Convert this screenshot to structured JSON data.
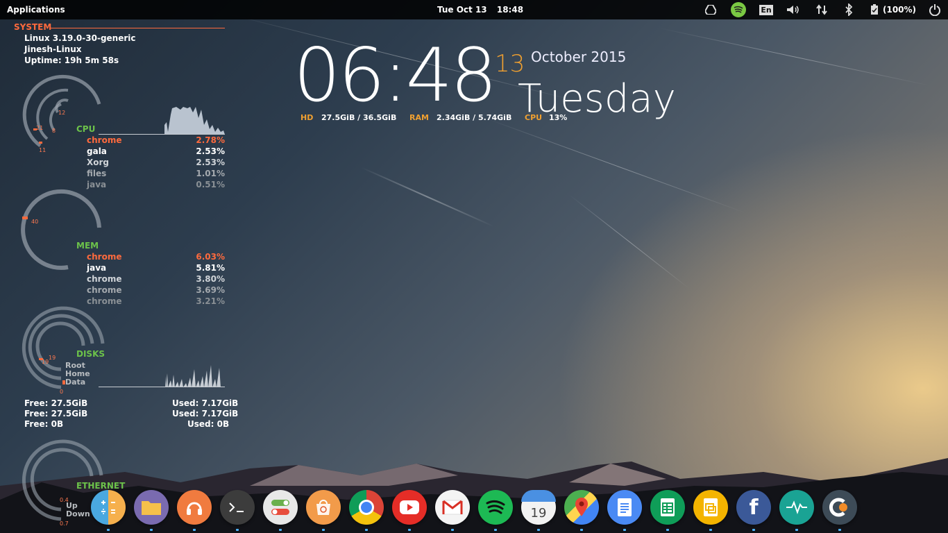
{
  "panel": {
    "apps_menu": "Applications",
    "date": "Tue Oct 13",
    "time": "18:48",
    "battery": "(100%)",
    "keyboard": "En"
  },
  "system": {
    "heading": "SYSTEM",
    "kernel": "Linux 3.19.0-30-generic",
    "host": "Jinesh-Linux",
    "uptime": "Uptime: 19h 5m 58s"
  },
  "cpu": {
    "label": "CPU",
    "ring_labels": [
      "12",
      "21",
      "8",
      "11"
    ],
    "processes": [
      {
        "name": "chrome",
        "value": "2.78%"
      },
      {
        "name": "gala",
        "value": "2.53%"
      },
      {
        "name": "Xorg",
        "value": "2.53%"
      },
      {
        "name": "files",
        "value": "1.01%"
      },
      {
        "name": "java",
        "value": "0.51%"
      }
    ]
  },
  "mem": {
    "label": "MEM",
    "ring_label": "40",
    "processes": [
      {
        "name": "chrome",
        "value": "6.03%"
      },
      {
        "name": "java",
        "value": "5.81%"
      },
      {
        "name": "chrome",
        "value": "3.80%"
      },
      {
        "name": "chrome",
        "value": "3.69%"
      },
      {
        "name": "chrome",
        "value": "3.21%"
      }
    ]
  },
  "disks": {
    "label": "DISKS",
    "ring_labels": [
      "19",
      "19",
      "0"
    ],
    "names": [
      "Root",
      "Home",
      "Data"
    ],
    "rows": [
      {
        "free": "Free: 27.5GiB",
        "used": "Used: 7.17GiB"
      },
      {
        "free": "Free: 27.5GiB",
        "used": "Used: 7.17GiB"
      },
      {
        "free": "Free: 0B",
        "used": "Used: 0B"
      }
    ]
  },
  "ethernet": {
    "label": "ETHERNET",
    "up_label": "Up",
    "down_label": "Down",
    "up_value": "0.4",
    "down_value": "0.7"
  },
  "clock": {
    "time": "06:48",
    "day": "13",
    "month_year": "October 2015",
    "weekday": "Tuesday"
  },
  "stats": {
    "hd_label": "HD",
    "hd_value": "27.5GiB / 36.5GiB",
    "ram_label": "RAM",
    "ram_value": "2.34GiB / 5.74GiB",
    "cpu_label": "CPU",
    "cpu_value": "13%"
  },
  "dock": [
    {
      "name": "calculator",
      "color": "#4aa8e0"
    },
    {
      "name": "files",
      "color": "#7a6bb0"
    },
    {
      "name": "music",
      "color": "#f07b3f"
    },
    {
      "name": "terminal",
      "color": "#3c3c3c"
    },
    {
      "name": "settings",
      "color": "#e8e8e8"
    },
    {
      "name": "app-center",
      "color": "#f29b4a"
    },
    {
      "name": "chrome",
      "color": "#ffffff"
    },
    {
      "name": "youtube",
      "color": "#e52d27"
    },
    {
      "name": "gmail",
      "color": "#ffffff"
    },
    {
      "name": "spotify",
      "color": "#1db954"
    },
    {
      "name": "calendar",
      "color": "#f2f2f2",
      "text": "19"
    },
    {
      "name": "maps",
      "color": "#4caf50"
    },
    {
      "name": "docs",
      "color": "#4a8af4"
    },
    {
      "name": "sheets",
      "color": "#0f9d58"
    },
    {
      "name": "slides",
      "color": "#f4b400"
    },
    {
      "name": "facebook",
      "color": "#3b5998",
      "text": "f"
    },
    {
      "name": "system-monitor",
      "color": "#1aa394"
    },
    {
      "name": "clementine",
      "color": "#3d4b57"
    }
  ]
}
